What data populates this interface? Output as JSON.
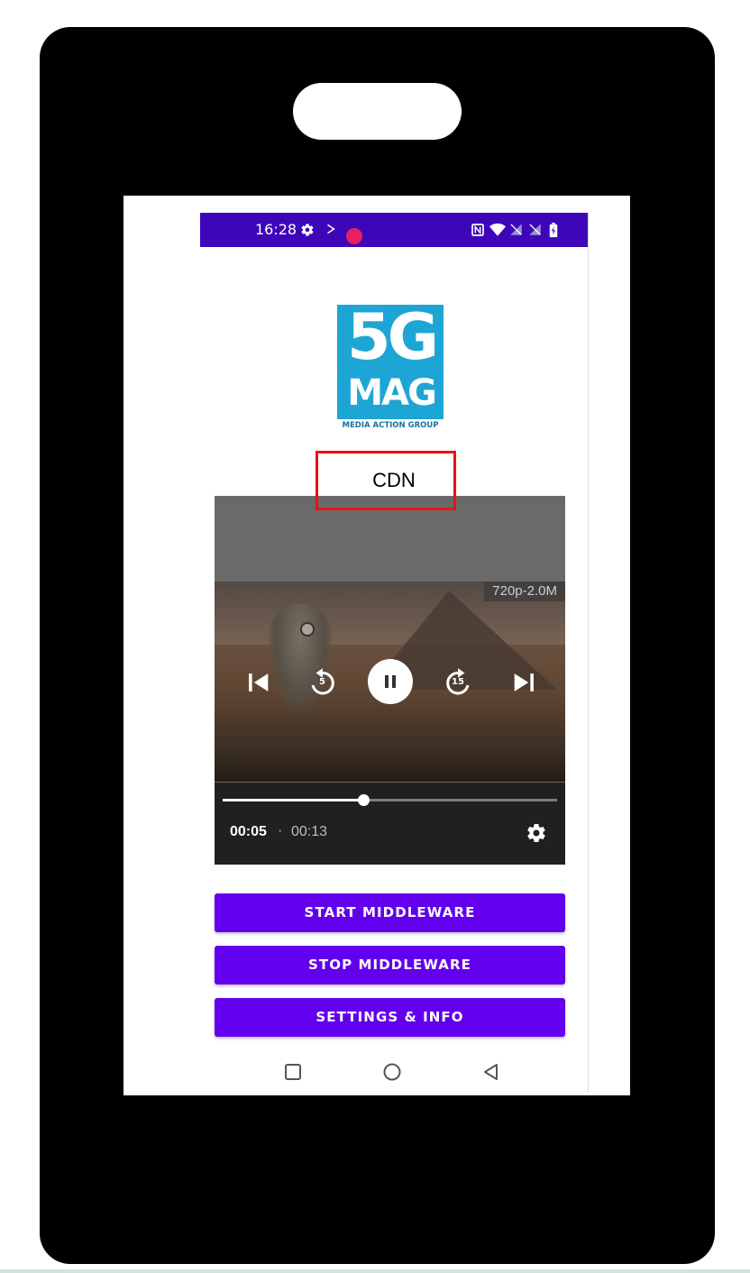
{
  "status_bar": {
    "time": "16:28",
    "left_icons": [
      "gear-icon",
      "cast-icon",
      "record-icon"
    ],
    "right_icons": [
      "nfc-icon",
      "wifi-icon",
      "no-signal-icon",
      "no-signal-icon",
      "battery-icon"
    ],
    "background_color": "#3e06b9"
  },
  "logo": {
    "primary_text": "5G",
    "secondary_text": "MAG",
    "tagline": "MEDIA ACTION GROUP",
    "brand_color": "#1da6d5"
  },
  "mode_label": "CDN",
  "highlight_color": "#ee1111",
  "player": {
    "quality_badge": "720p-2.0M",
    "controls": {
      "replay_seconds": "5",
      "forward_seconds": "15"
    },
    "position": "00:05",
    "separator": "·",
    "duration": "00:13",
    "progress_fraction": 0.42
  },
  "buttons": {
    "start": "START MIDDLEWARE",
    "stop": "STOP MIDDLEWARE",
    "settings": "SETTINGS & INFO",
    "color": "#6200ee"
  },
  "nav_bar": {
    "items": [
      "recents-square-icon",
      "home-circle-icon",
      "back-triangle-icon"
    ]
  }
}
